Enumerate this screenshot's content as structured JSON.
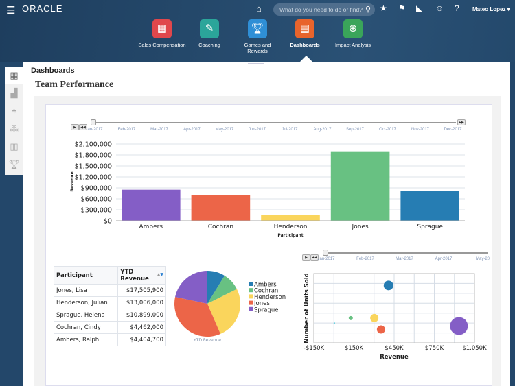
{
  "header": {
    "logo": "ORACLE",
    "search_placeholder": "What do you need to do or find?",
    "user": "Mateo Lopez ▾",
    "icons": [
      "menu-icon",
      "home-icon",
      "search-icon",
      "star-icon",
      "flag-icon",
      "bell-icon",
      "accessibility-icon",
      "help-icon"
    ]
  },
  "apps": [
    {
      "label": "Sales Compensation",
      "color": "#e0474c",
      "icon": "sales-compensation-icon"
    },
    {
      "label": "Coaching",
      "color": "#2ba59a",
      "icon": "coaching-icon"
    },
    {
      "label": "Games and Rewards",
      "color": "#2f8fd6",
      "icon": "trophy-icon"
    },
    {
      "label": "Dashboards",
      "color": "#e8642c",
      "icon": "dashboard-icon",
      "selected": true
    },
    {
      "label": "Impact Analysis",
      "color": "#3aa55a",
      "icon": "impact-analysis-icon"
    }
  ],
  "page": {
    "section": "Dashboards",
    "title": "Team Performance"
  },
  "months": [
    "Jan-2017",
    "Feb-2017",
    "Mar-2017",
    "Apr-2017",
    "May-2017",
    "Jun-2017",
    "Jul-2017",
    "Aug-2017",
    "Sep-2017",
    "Oct-2017",
    "Nov-2017",
    "Dec-2017"
  ],
  "scatter_months": [
    "Jan-2017",
    "Feb-2017",
    "Mar-2017",
    "Apr-2017",
    "May-20"
  ],
  "table": {
    "headers": [
      "Participant",
      "YTD Revenue"
    ],
    "rows": [
      [
        "Jones, Lisa",
        "$17,505,900"
      ],
      [
        "Henderson, Julian",
        "$13,006,000"
      ],
      [
        "Sprague, Helena",
        "$10,899,000"
      ],
      [
        "Cochran, Cindy",
        "$4,462,000"
      ],
      [
        "Ambers, Ralph",
        "$4,404,700"
      ]
    ]
  },
  "chart_data": [
    {
      "type": "bar",
      "categories": [
        "Ambers",
        "Cochran",
        "Henderson",
        "Jones",
        "Sprague"
      ],
      "values": [
        850000,
        700000,
        150000,
        1900000,
        820000
      ],
      "colors": [
        "#845ec6",
        "#ec6548",
        "#fad55c",
        "#68c182",
        "#267db3"
      ],
      "xlabel": "Participant",
      "ylabel": "Revenue",
      "ylim": [
        0,
        2100000
      ],
      "ticks": [
        "$0",
        "$300,000",
        "$600,000",
        "$900,000",
        "$1,200,000",
        "$1,500,000",
        "$1,800,000",
        "$2,100,000"
      ],
      "grid": true
    },
    {
      "type": "pie",
      "categories": [
        "Ambers",
        "Cochran",
        "Henderson",
        "Jones",
        "Sprague"
      ],
      "values": [
        4404700,
        4462000,
        13006000,
        17505900,
        10899000
      ],
      "colors": [
        "#267db3",
        "#68c182",
        "#fad55c",
        "#ec6548",
        "#845ec6"
      ],
      "xlabel": "YTD Revenue",
      "legend": "right"
    },
    {
      "type": "scatter",
      "xlabel": "Revenue",
      "ylabel": "Number of Units Sold",
      "xlim": [
        -150,
        1050
      ],
      "ylim": [
        0,
        7
      ],
      "xticks": [
        "-$150K",
        "$150K",
        "$450K",
        "$750K",
        "$1,050K"
      ],
      "grid": true,
      "points": [
        {
          "x": 3,
          "y": 2.0,
          "size": 1,
          "color": "#3fc6d9"
        },
        {
          "x": 126,
          "y": 2.5,
          "size": 3,
          "color": "#68c182"
        },
        {
          "x": 302,
          "y": 2.5,
          "size": 6,
          "color": "#fad55c"
        },
        {
          "x": 352,
          "y": 1.35,
          "size": 6,
          "color": "#ec6548"
        },
        {
          "x": 408,
          "y": 5.8,
          "size": 7,
          "color": "#267db3"
        },
        {
          "x": 934,
          "y": 1.7,
          "size": 13,
          "color": "#845ec6"
        }
      ]
    }
  ]
}
